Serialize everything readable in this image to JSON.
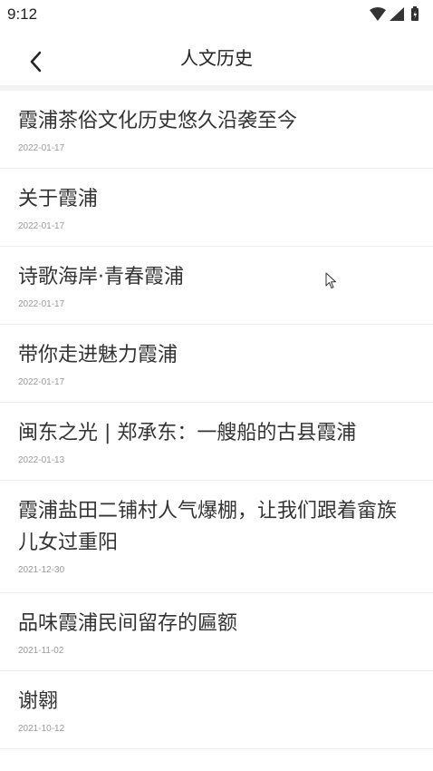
{
  "status_bar": {
    "time": "9:12"
  },
  "header": {
    "title": "人文历史",
    "back_icon": "chevron-left-icon"
  },
  "articles": [
    {
      "title": "霞浦茶俗文化历史悠久沿袭至今",
      "date": "2022-01-17"
    },
    {
      "title": "关于霞浦",
      "date": "2022-01-17"
    },
    {
      "title": "诗歌海岸·青春霞浦",
      "date": "2022-01-17"
    },
    {
      "title": "带你走进魅力霞浦",
      "date": "2022-01-17"
    },
    {
      "title": "闽东之光 | 郑承东：一艘船的古县霞浦",
      "date": "2022-01-13"
    },
    {
      "title": "霞浦盐田二铺村人气爆棚，让我们跟着畲族儿女过重阳",
      "date": "2021-12-30"
    },
    {
      "title": "品味霞浦民间留存的匾额",
      "date": "2021-11-02"
    },
    {
      "title": "谢翱",
      "date": "2021-10-12"
    }
  ],
  "colors": {
    "background": "#ffffff",
    "divider": "#f2f2f2",
    "title_text": "#333333",
    "date_text": "#999999"
  }
}
